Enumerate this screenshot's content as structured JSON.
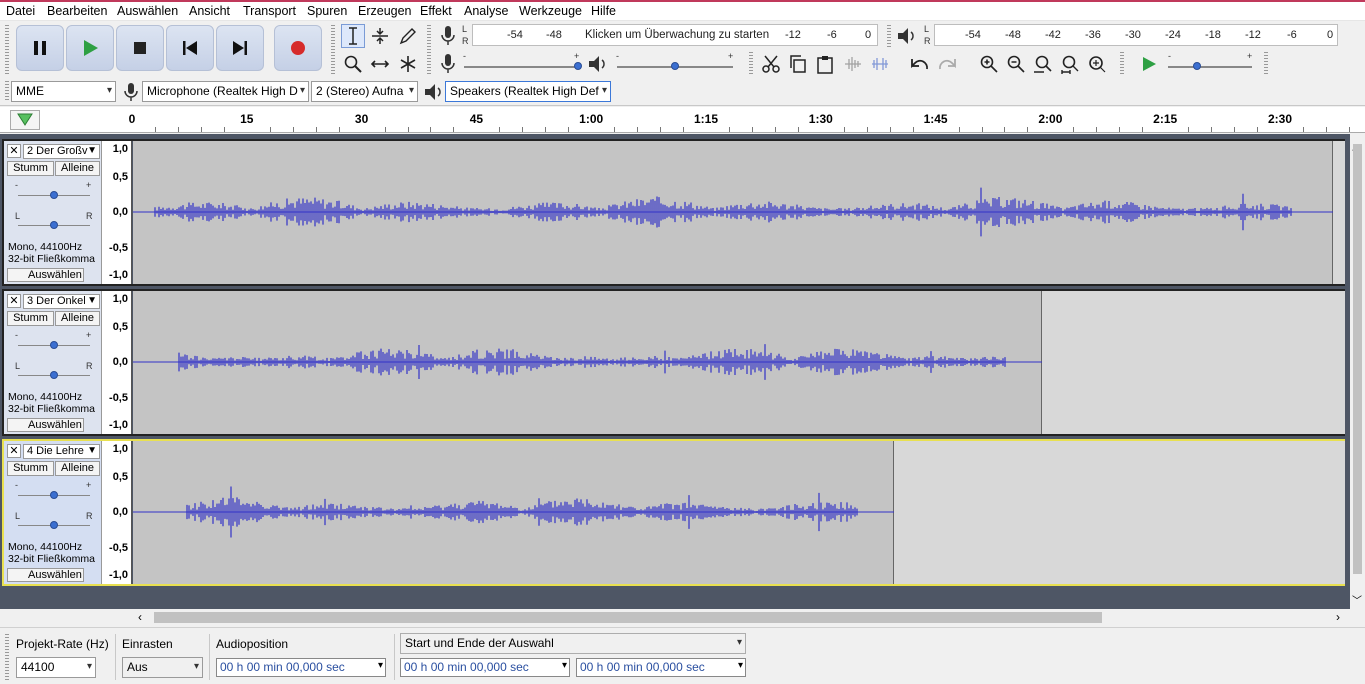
{
  "menu": [
    "Datei",
    "Bearbeiten",
    "Auswählen",
    "Ansicht",
    "Transport",
    "Spuren",
    "Erzeugen",
    "Effekt",
    "Analyse",
    "Werkzeuge",
    "Hilfe"
  ],
  "recording_meter": {
    "channels": [
      "L",
      "R"
    ],
    "ticks": [
      "-54",
      "-48",
      "-12",
      "-6",
      "0"
    ],
    "prompt": "Klicken um Überwachung zu starten"
  },
  "playback_meter": {
    "channels": [
      "L",
      "R"
    ],
    "ticks": [
      "-54",
      "-48",
      "-42",
      "-36",
      "-30",
      "-24",
      "-18",
      "-12",
      "-6",
      "0"
    ]
  },
  "device_toolbar": {
    "host": "MME",
    "recording_device": "Microphone (Realtek High D",
    "recording_channels": "2 (Stereo) Aufna",
    "playback_device": "Speakers (Realtek High Def"
  },
  "timeline": {
    "labels": [
      "0",
      "15",
      "30",
      "45",
      "1:00",
      "1:15",
      "1:30",
      "1:45",
      "2:00",
      "2:15",
      "2:30"
    ]
  },
  "amplitude_scale": [
    "1,0",
    "0,5",
    "0,0",
    "-0,5",
    "-1,0"
  ],
  "tracks": [
    {
      "name": "2 Der Großv",
      "info_line1": "Mono, 44100Hz",
      "info_line2": "32-bit Fließkomma",
      "clip_end_fraction": 0.99,
      "selected": false
    },
    {
      "name": "3 Der Onkel",
      "info_line1": "Mono, 44100Hz",
      "info_line2": "32-bit Fließkomma",
      "clip_end_fraction": 0.75,
      "selected": false
    },
    {
      "name": "4 Die Lehre",
      "info_line1": "Mono, 44100Hz",
      "info_line2": "32-bit Fließkomma",
      "clip_end_fraction": 0.628,
      "selected": true
    }
  ],
  "track_buttons": {
    "mute": "Stumm",
    "solo": "Alleine",
    "select": "Auswählen",
    "pan_left": "L",
    "pan_right": "R",
    "gain_minus": "-",
    "gain_plus": "+"
  },
  "selection_toolbar": {
    "rate_label": "Projekt-Rate (Hz)",
    "rate_value": "44100",
    "snap_label": "Einrasten",
    "snap_value": "Aus",
    "audio_position_label": "Audioposition",
    "selection_mode": "Start und Ende der Auswahl",
    "audio_position": "00 h 00 min 00,000 sec",
    "selection_start": "00 h 00 min 00,000 sec",
    "selection_end": "00 h 00 min 00,000 sec"
  },
  "colors": {
    "waveform": "#3232c8",
    "accent_red": "#d62b2b",
    "play_green": "#2ea043"
  }
}
